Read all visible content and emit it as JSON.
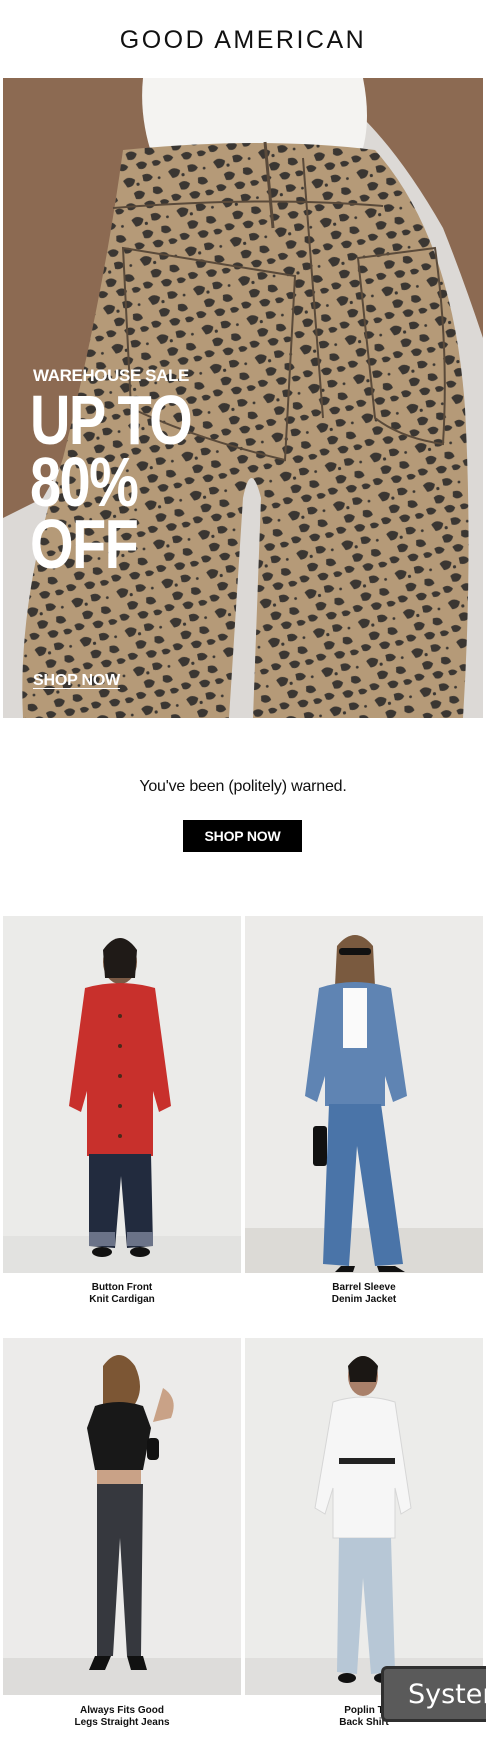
{
  "header": {
    "brand": "GOOD AMERICAN"
  },
  "hero": {
    "eyebrow": "WAREHOUSE SALE",
    "headline_line1": "UP TO",
    "headline_line2": "80% OFF",
    "cta": "SHOP NOW",
    "image_subject": "leopard-print-jeans-back-view"
  },
  "intro": {
    "tagline": "You've been (politely) warned.",
    "cta": "SHOP NOW"
  },
  "products": [
    {
      "line1": "Button Front",
      "line2": "Knit Cardigan",
      "image": "model-red-cardigan-dark-jeans"
    },
    {
      "line1": "Barrel Sleeve",
      "line2": "Denim Jacket",
      "image": "model-denim-jacket-flare-jeans"
    },
    {
      "line1": "Always Fits Good",
      "line2": "Legs Straight Jeans",
      "image": "model-black-tee-straight-jeans"
    },
    {
      "line1": "Poplin T",
      "line2": "Back Shirt",
      "image": "model-white-shirt-light-jeans"
    }
  ],
  "toast": {
    "label": "Syster"
  },
  "colors": {
    "button_bg": "#000000",
    "text": "#111111",
    "toast_bg": "#5a5a5a"
  }
}
